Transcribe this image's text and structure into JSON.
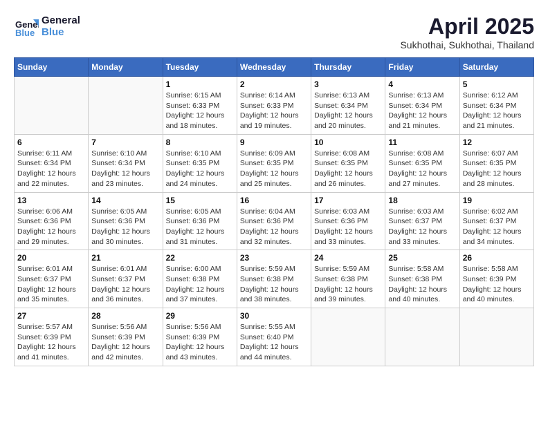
{
  "header": {
    "logo_line1": "General",
    "logo_line2": "Blue",
    "month": "April 2025",
    "location": "Sukhothai, Sukhothai, Thailand"
  },
  "weekdays": [
    "Sunday",
    "Monday",
    "Tuesday",
    "Wednesday",
    "Thursday",
    "Friday",
    "Saturday"
  ],
  "weeks": [
    [
      {
        "day": "",
        "info": ""
      },
      {
        "day": "",
        "info": ""
      },
      {
        "day": "1",
        "info": "Sunrise: 6:15 AM\nSunset: 6:33 PM\nDaylight: 12 hours and 18 minutes."
      },
      {
        "day": "2",
        "info": "Sunrise: 6:14 AM\nSunset: 6:33 PM\nDaylight: 12 hours and 19 minutes."
      },
      {
        "day": "3",
        "info": "Sunrise: 6:13 AM\nSunset: 6:34 PM\nDaylight: 12 hours and 20 minutes."
      },
      {
        "day": "4",
        "info": "Sunrise: 6:13 AM\nSunset: 6:34 PM\nDaylight: 12 hours and 21 minutes."
      },
      {
        "day": "5",
        "info": "Sunrise: 6:12 AM\nSunset: 6:34 PM\nDaylight: 12 hours and 21 minutes."
      }
    ],
    [
      {
        "day": "6",
        "info": "Sunrise: 6:11 AM\nSunset: 6:34 PM\nDaylight: 12 hours and 22 minutes."
      },
      {
        "day": "7",
        "info": "Sunrise: 6:10 AM\nSunset: 6:34 PM\nDaylight: 12 hours and 23 minutes."
      },
      {
        "day": "8",
        "info": "Sunrise: 6:10 AM\nSunset: 6:35 PM\nDaylight: 12 hours and 24 minutes."
      },
      {
        "day": "9",
        "info": "Sunrise: 6:09 AM\nSunset: 6:35 PM\nDaylight: 12 hours and 25 minutes."
      },
      {
        "day": "10",
        "info": "Sunrise: 6:08 AM\nSunset: 6:35 PM\nDaylight: 12 hours and 26 minutes."
      },
      {
        "day": "11",
        "info": "Sunrise: 6:08 AM\nSunset: 6:35 PM\nDaylight: 12 hours and 27 minutes."
      },
      {
        "day": "12",
        "info": "Sunrise: 6:07 AM\nSunset: 6:35 PM\nDaylight: 12 hours and 28 minutes."
      }
    ],
    [
      {
        "day": "13",
        "info": "Sunrise: 6:06 AM\nSunset: 6:36 PM\nDaylight: 12 hours and 29 minutes."
      },
      {
        "day": "14",
        "info": "Sunrise: 6:05 AM\nSunset: 6:36 PM\nDaylight: 12 hours and 30 minutes."
      },
      {
        "day": "15",
        "info": "Sunrise: 6:05 AM\nSunset: 6:36 PM\nDaylight: 12 hours and 31 minutes."
      },
      {
        "day": "16",
        "info": "Sunrise: 6:04 AM\nSunset: 6:36 PM\nDaylight: 12 hours and 32 minutes."
      },
      {
        "day": "17",
        "info": "Sunrise: 6:03 AM\nSunset: 6:36 PM\nDaylight: 12 hours and 33 minutes."
      },
      {
        "day": "18",
        "info": "Sunrise: 6:03 AM\nSunset: 6:37 PM\nDaylight: 12 hours and 33 minutes."
      },
      {
        "day": "19",
        "info": "Sunrise: 6:02 AM\nSunset: 6:37 PM\nDaylight: 12 hours and 34 minutes."
      }
    ],
    [
      {
        "day": "20",
        "info": "Sunrise: 6:01 AM\nSunset: 6:37 PM\nDaylight: 12 hours and 35 minutes."
      },
      {
        "day": "21",
        "info": "Sunrise: 6:01 AM\nSunset: 6:37 PM\nDaylight: 12 hours and 36 minutes."
      },
      {
        "day": "22",
        "info": "Sunrise: 6:00 AM\nSunset: 6:38 PM\nDaylight: 12 hours and 37 minutes."
      },
      {
        "day": "23",
        "info": "Sunrise: 5:59 AM\nSunset: 6:38 PM\nDaylight: 12 hours and 38 minutes."
      },
      {
        "day": "24",
        "info": "Sunrise: 5:59 AM\nSunset: 6:38 PM\nDaylight: 12 hours and 39 minutes."
      },
      {
        "day": "25",
        "info": "Sunrise: 5:58 AM\nSunset: 6:38 PM\nDaylight: 12 hours and 40 minutes."
      },
      {
        "day": "26",
        "info": "Sunrise: 5:58 AM\nSunset: 6:39 PM\nDaylight: 12 hours and 40 minutes."
      }
    ],
    [
      {
        "day": "27",
        "info": "Sunrise: 5:57 AM\nSunset: 6:39 PM\nDaylight: 12 hours and 41 minutes."
      },
      {
        "day": "28",
        "info": "Sunrise: 5:56 AM\nSunset: 6:39 PM\nDaylight: 12 hours and 42 minutes."
      },
      {
        "day": "29",
        "info": "Sunrise: 5:56 AM\nSunset: 6:39 PM\nDaylight: 12 hours and 43 minutes."
      },
      {
        "day": "30",
        "info": "Sunrise: 5:55 AM\nSunset: 6:40 PM\nDaylight: 12 hours and 44 minutes."
      },
      {
        "day": "",
        "info": ""
      },
      {
        "day": "",
        "info": ""
      },
      {
        "day": "",
        "info": ""
      }
    ]
  ]
}
